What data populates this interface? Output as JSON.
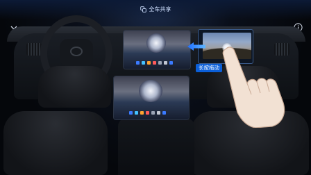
{
  "header": {
    "title": "全车共享",
    "share_icon": "share-devices-icon"
  },
  "controls": {
    "close_icon": "close-icon",
    "info_icon": "info-icon"
  },
  "tutorial": {
    "hint_label": "长按拖动",
    "gesture_icon": "hand-drag-gesture-icon",
    "direction_icon": "left-arrow-icon"
  },
  "colors": {
    "accent": "#0b5fd9",
    "arrow": "#2a8cff",
    "background": "#05070b"
  }
}
